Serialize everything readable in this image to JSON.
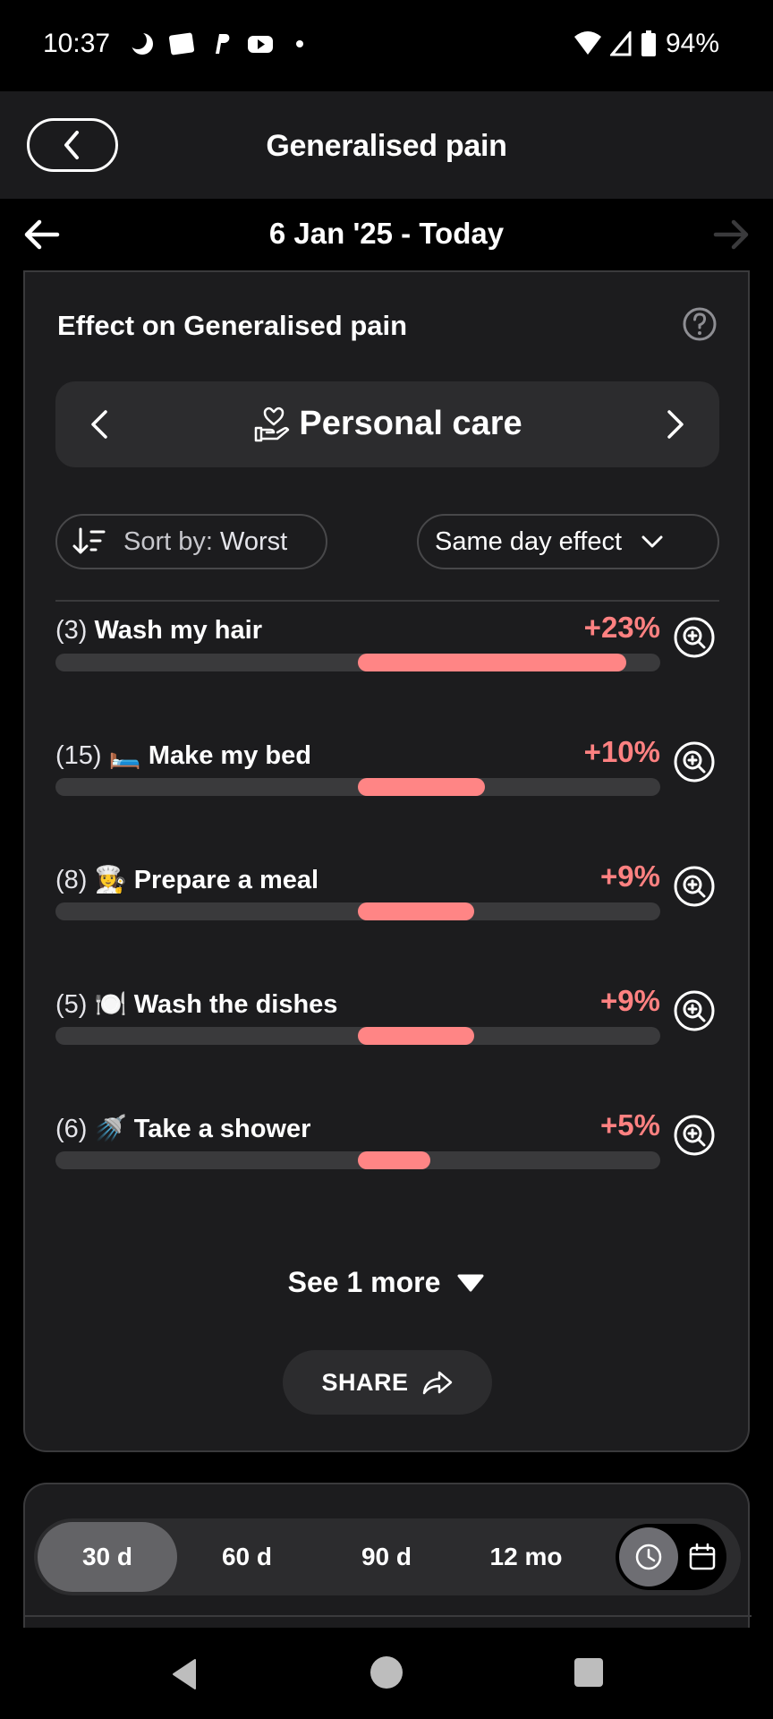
{
  "status_bar": {
    "time": "10:37",
    "battery": "94%",
    "notification_icons": [
      "moon-icon",
      "webtoon-icon",
      "paypal-icon",
      "youtube-icon",
      "dot-icon"
    ]
  },
  "header": {
    "title": "Generalised pain"
  },
  "date_range": {
    "label": "6 Jan '25 - Today"
  },
  "card": {
    "title": "Effect on Generalised pain",
    "category": {
      "label": "Personal care",
      "icon": "heart-hand-icon"
    },
    "sort": {
      "prefix": "Sort by:",
      "value": " Worst"
    },
    "effect_select": {
      "value": "Same day effect"
    },
    "items": [
      {
        "count": "(3)",
        "emoji": "",
        "name": "Wash my hair",
        "pct": "+23%",
        "value": 23
      },
      {
        "count": "(15)",
        "emoji": "🛏️",
        "name": "Make my bed",
        "pct": "+10%",
        "value": 10
      },
      {
        "count": "(8)",
        "emoji": "👩‍🍳",
        "name": "Prepare a meal",
        "pct": "+9%",
        "value": 9
      },
      {
        "count": "(5)",
        "emoji": "🍽️",
        "name": "Wash the dishes",
        "pct": "+9%",
        "value": 9
      },
      {
        "count": "(6)",
        "emoji": "🚿",
        "name": "Take a shower",
        "pct": "+5%",
        "value": 5
      }
    ],
    "see_more": "See 1 more",
    "share": "SHARE"
  },
  "range": {
    "options": [
      "30 d",
      "60 d",
      "90 d",
      "12 mo"
    ],
    "selected": "30 d"
  },
  "colors": {
    "accent_negative": "#ff8585",
    "background": "#000000",
    "card": "#1c1c1e"
  }
}
